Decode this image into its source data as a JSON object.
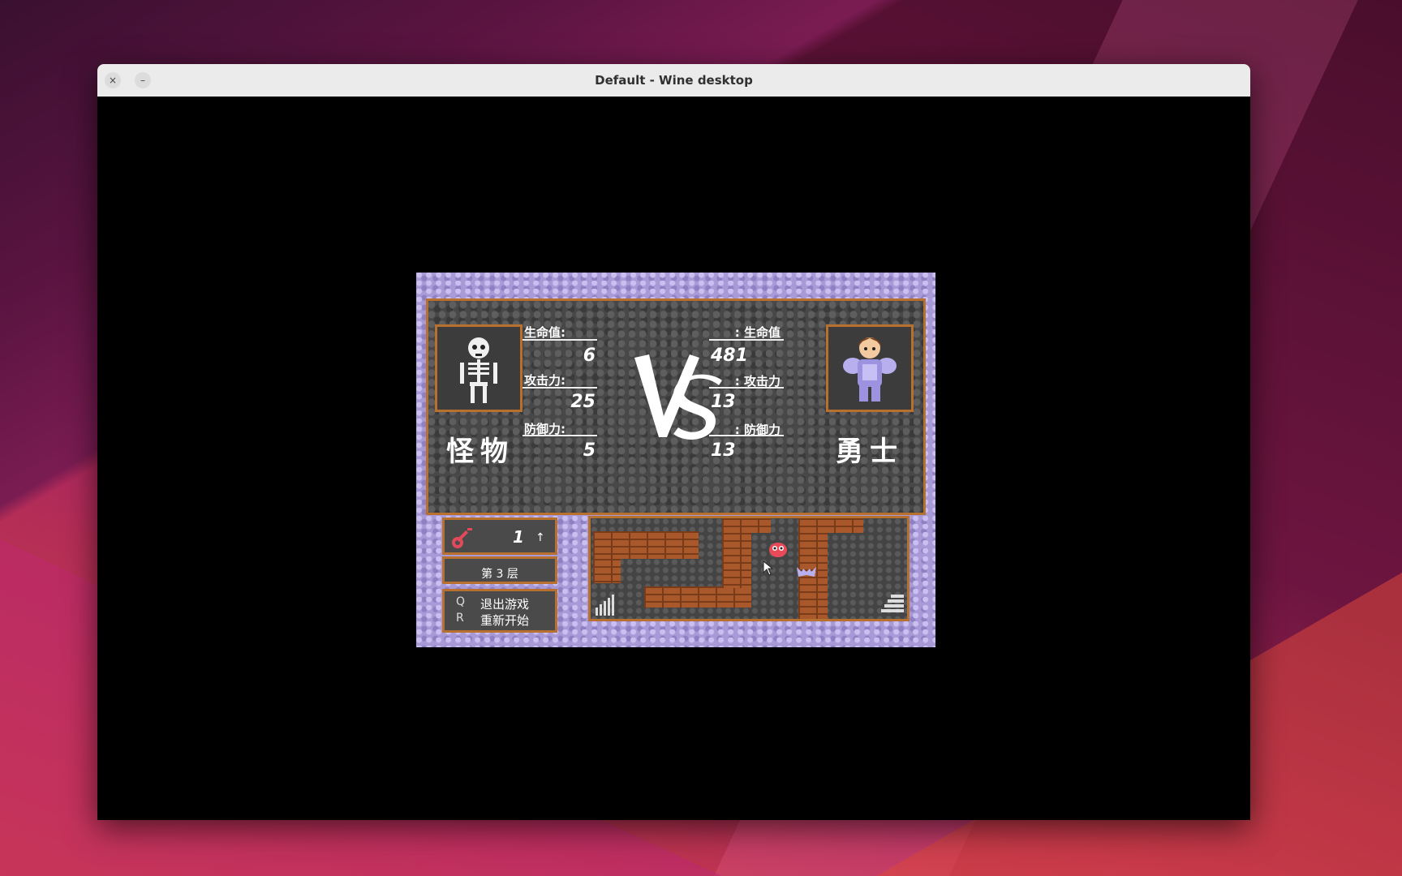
{
  "window": {
    "title": "Default - Wine desktop",
    "close_glyph": "×",
    "minimize_glyph": "–"
  },
  "battle": {
    "monster": {
      "name": "怪物",
      "hp_label": "生命值:",
      "hp": "6",
      "atk_label": "攻击力:",
      "atk": "25",
      "def_label": "防御力:",
      "def": "5",
      "icon": "skeleton-icon"
    },
    "hero": {
      "name": "勇士",
      "hp_label": ": 生命值",
      "hp": "481",
      "atk_label": ": 攻击力",
      "atk": "13",
      "def_label": ": 防御力",
      "def": "13",
      "icon": "hero-knight-icon"
    },
    "vs_text": "VS"
  },
  "sidebar": {
    "key_count": "1",
    "key_arrow": "↑",
    "floor_label": "第 3 层",
    "menu": [
      {
        "key": "Q",
        "label": "退出游戏"
      },
      {
        "key": "R",
        "label": "重新开始"
      }
    ]
  },
  "colors": {
    "frame": "#b8702e",
    "stone": "#484848",
    "border_tile": "#a89ad6"
  }
}
